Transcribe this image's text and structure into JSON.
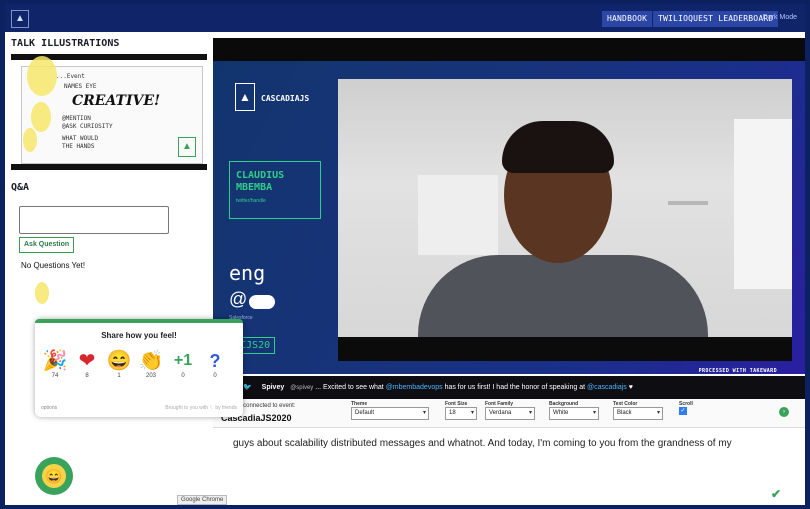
{
  "topbar": {
    "logo_icon": "tree-icon",
    "handbook_label": "HANDBOOK",
    "leaderboard_label": "TWILIOQUEST LEADERBOARD",
    "small_label": "Dark Mode"
  },
  "left": {
    "talk_title": "TALK ILLUSTRATIONS",
    "illus_lines": [
      "...Event",
      "NAMES EYE",
      "@MENTION",
      "@ASK CURIOSITY",
      "WHAT WOULD",
      "THE HANDS"
    ],
    "illus_big": "CREATIVE!",
    "qa_title": "Q&A",
    "ask_button": "Ask Question",
    "no_questions": "No Questions Yet!"
  },
  "feelings": {
    "title": "Share how you feel!",
    "reactions": [
      {
        "icon": "🎉",
        "name": "party-icon",
        "count": "74"
      },
      {
        "icon": "❤",
        "name": "heart-icon",
        "count": "8"
      },
      {
        "icon": "😄",
        "name": "grin-icon",
        "count": "1"
      },
      {
        "icon": "👏",
        "name": "clap-icon",
        "count": "203"
      },
      {
        "icon": "+1",
        "name": "plus-one-icon",
        "count": "0"
      },
      {
        "icon": "?",
        "name": "question-icon",
        "count": "0"
      }
    ],
    "foot_left": "options",
    "foot_right": "Brought to you with ♡ by friends"
  },
  "fab_icon": "😄",
  "chrome_label": "Google Chrome",
  "stage": {
    "logo_text": "CASCADIAJS",
    "speaker_name": "CLAUDIUS\nMBEMBA",
    "speaker_handle": "twitter/handle",
    "eng": "eng",
    "sf_at": "@",
    "sf_small": "Salesforce",
    "hashtag": "#CJS20",
    "captioned_by": "PROCESSED WITH TAKEWARD"
  },
  "ticker": {
    "user": "Spivey",
    "handle": "@spivey",
    "text_a": "... Excited to see what ",
    "mention": "@mbembadevops",
    "text_b": " has for us first! I had the honor of speaking at ",
    "mention2": "@cascadiajs",
    "text_c": " ♥"
  },
  "captions": {
    "connected_text": "You are connected to event:",
    "event_name": "CascadiaJS2020",
    "controls": [
      {
        "label": "Theme",
        "value": "Default",
        "name": "theme-select"
      },
      {
        "label": "Font Size",
        "value": "18",
        "name": "font-size-select"
      },
      {
        "label": "Font Family",
        "value": "Verdana",
        "name": "font-family-select"
      },
      {
        "label": "Background",
        "value": "White",
        "name": "background-select"
      },
      {
        "label": "Text Color",
        "value": "Black",
        "name": "text-color-select"
      }
    ],
    "scroll_label": "Scroll",
    "text": "guys about scalability distributed messages and whatnot.  And today, I'm coming to you from the grandness of my"
  },
  "colors": {
    "brand_dark": "#10246a",
    "accent_green": "#3aa35b",
    "stage_green": "#2fcf88"
  }
}
